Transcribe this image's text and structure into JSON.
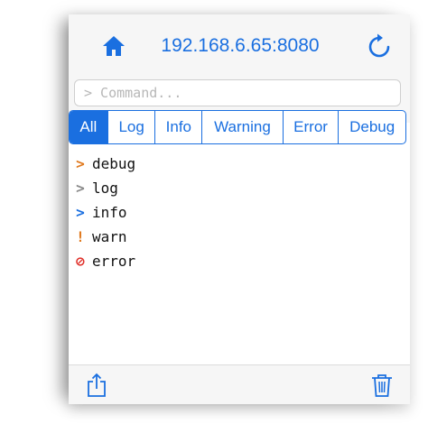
{
  "toolbar": {
    "address": "192.168.6.65:8080",
    "home_icon": "home-icon",
    "reload_icon": "reload-icon"
  },
  "command": {
    "placeholder": "> Command..."
  },
  "filters": {
    "tabs": [
      "All",
      "Log",
      "Info",
      "Warning",
      "Error",
      "Debug"
    ],
    "active": "All"
  },
  "log": {
    "entries": [
      {
        "glyph": ">",
        "text": "debug",
        "color": "#e07a1f"
      },
      {
        "glyph": ">",
        "text": "log",
        "color": "#8a8a8a"
      },
      {
        "glyph": ">",
        "text": "info",
        "color": "#1a6fe0"
      },
      {
        "glyph": "!",
        "text": "warn",
        "color": "#e07a1f"
      },
      {
        "glyph": "⊘",
        "text": "error",
        "color": "#e0302a"
      }
    ]
  },
  "bottom": {
    "share_icon": "share-icon",
    "trash_icon": "trash-icon"
  },
  "colors": {
    "accent": "#1a6fe0",
    "bar": "#f6f6f6"
  }
}
